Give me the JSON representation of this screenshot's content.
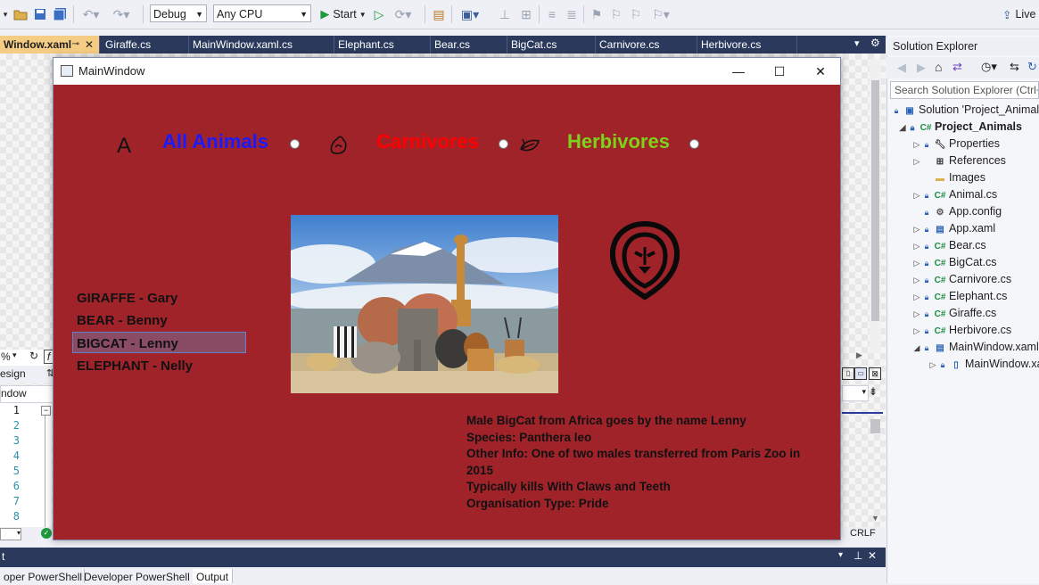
{
  "toolbar": {
    "config_value": "Debug",
    "platform_value": "Any CPU",
    "start_label": "Start",
    "live_label": "Live"
  },
  "tabs": [
    {
      "label": "Window.xaml",
      "active": true
    },
    {
      "label": "Giraffe.cs"
    },
    {
      "label": "MainWindow.xaml.cs"
    },
    {
      "label": "Elephant.cs"
    },
    {
      "label": "Bear.cs"
    },
    {
      "label": "BigCat.cs"
    },
    {
      "label": "Carnivore.cs"
    },
    {
      "label": "Herbivore.cs"
    }
  ],
  "editor": {
    "zoom": "%",
    "design_label": "esign",
    "window_combo": "ndow",
    "line_numbers": [
      "1",
      "2",
      "3",
      "4",
      "5",
      "6",
      "7",
      "8"
    ],
    "status_crlf": "CRLF"
  },
  "output_panel": {
    "header": "t",
    "tabs": [
      "oper PowerShell",
      "Developer PowerShell",
      "Output"
    ]
  },
  "solution_explorer": {
    "title": "Solution Explorer",
    "search_placeholder": "Search Solution Explorer (Ctrl+;)",
    "items": [
      {
        "label": "Solution 'Project_Animals'",
        "icon": "solution-icon"
      },
      {
        "label": "Project_Animals",
        "icon": "csproj-icon"
      },
      {
        "label": "Properties",
        "icon": "wrench-icon"
      },
      {
        "label": "References",
        "icon": "references-icon"
      },
      {
        "label": "Images",
        "icon": "folder-icon"
      },
      {
        "label": "Animal.cs",
        "icon": "csharp-icon"
      },
      {
        "label": "App.config",
        "icon": "config-icon"
      },
      {
        "label": "App.xaml",
        "icon": "xaml-icon"
      },
      {
        "label": "Bear.cs",
        "icon": "csharp-icon"
      },
      {
        "label": "BigCat.cs",
        "icon": "csharp-icon"
      },
      {
        "label": "Carnivore.cs",
        "icon": "csharp-icon"
      },
      {
        "label": "Elephant.cs",
        "icon": "csharp-icon"
      },
      {
        "label": "Giraffe.cs",
        "icon": "csharp-icon"
      },
      {
        "label": "Herbivore.cs",
        "icon": "csharp-icon"
      },
      {
        "label": "MainWindow.xaml",
        "icon": "xaml-icon"
      },
      {
        "label": "MainWindow.xaml.cs",
        "icon": "xaml-cs-icon"
      }
    ]
  },
  "app_window": {
    "title": "MainWindow",
    "background": "#a0232a",
    "filters": [
      {
        "label": "All Animals",
        "icon": "letter-a-icon",
        "icon_text": "A",
        "color": "#1a1aff"
      },
      {
        "label": "Carnivores",
        "icon": "paw-icon",
        "color": "#ff0000"
      },
      {
        "label": "Herbivores",
        "icon": "leaf-icon",
        "color": "#7cd319"
      }
    ],
    "animals": [
      "GIRAFFE - Gary",
      "BEAR - Benny",
      "BIGCAT - Lenny",
      "ELEPHANT - Nelly"
    ],
    "selected_index": 2,
    "details": [
      "Male BigCat from Africa goes by the name Lenny",
      "Species: Panthera leo",
      "Other Info: One of two males transferred from Paris Zoo in 2015",
      "Typically kills With Claws and Teeth",
      "Organisation Type: Pride"
    ]
  }
}
